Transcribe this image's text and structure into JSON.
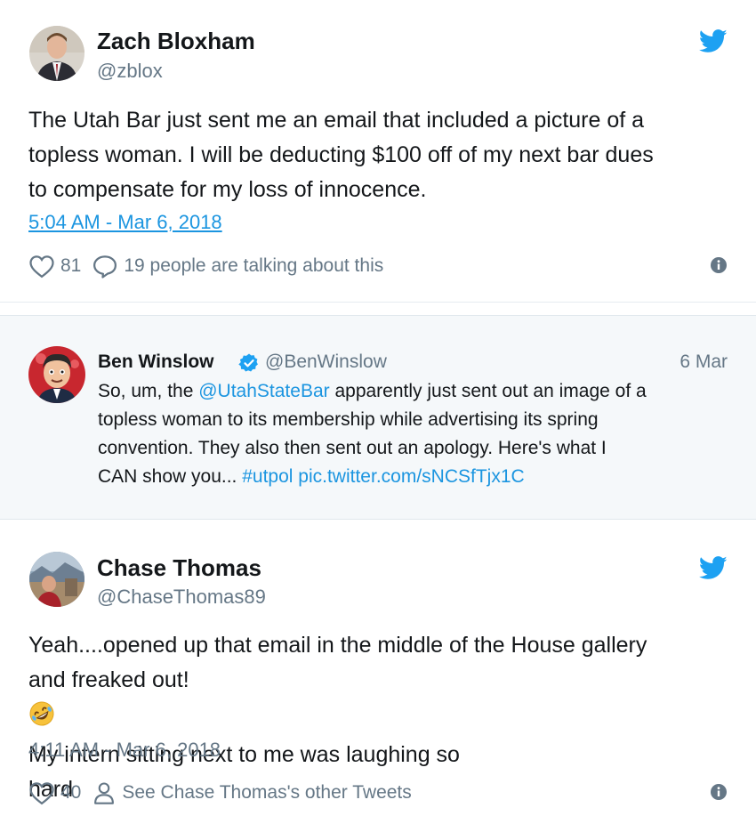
{
  "tweet1": {
    "name": "Zach Bloxham",
    "handle": "@zblox",
    "text_lines": [
      "The Utah Bar just sent me an email that included a picture of a",
      "topless woman. I will be deducting $100 off of my next bar dues",
      "to compensate for my loss of innocence."
    ],
    "timestamp": "5:04 AM - Mar 6, 2018",
    "likes": "81",
    "talking": "19 people are talking about this",
    "icons": {
      "brand": "twitter-bird-icon",
      "like": "heart-icon",
      "reply": "speech-bubble-icon",
      "info": "info-icon"
    }
  },
  "quoted": {
    "name": "Ben Winslow",
    "handle": "@BenWinslow",
    "date": "6 Mar",
    "line1_mention": "@UtahStateBar",
    "line1_pre": "So, um, the ",
    "line1_post": " apparently just sent out an image of a",
    "line2": "topless woman to its membership while advertising its spring",
    "line3": "convention. They also then sent out an apology. Here's what I",
    "line4_pre": "CAN show you... ",
    "line4_hashtag": "#utpol",
    "line4_link": " pic.twitter.com/sNCSfTjx1C",
    "verified_icon": "verified-badge-icon"
  },
  "tweet2": {
    "name": "Chase Thomas",
    "handle": "@ChaseThomas89",
    "line1": "Yeah....opened up that email in the middle of the House gallery",
    "line2_pre": "and freaked out! ",
    "line2_post": " My intern sitting next to me was laughing so",
    "line3": "hard",
    "emoji": "rolling-on-floor-laughing-emoji",
    "timestamp": "4:11 AM - Mar 6, 2018",
    "likes": "40",
    "other_tweets": "See Chase Thomas's other Tweets",
    "icons": {
      "brand": "twitter-bird-icon",
      "like": "heart-icon",
      "person": "person-icon",
      "info": "info-icon"
    }
  },
  "colors": {
    "twitter_blue": "#1da1f2",
    "link_blue": "#1b95e0",
    "text": "#14171a",
    "secondary": "#657786",
    "quoted_bg": "#f5f8fa"
  }
}
